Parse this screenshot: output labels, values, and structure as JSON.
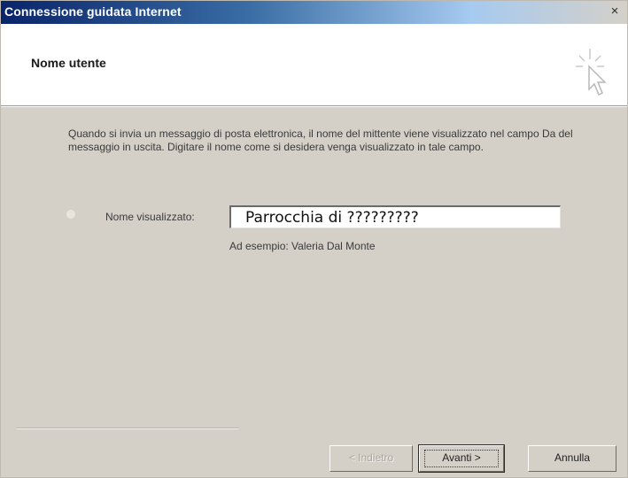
{
  "window": {
    "title": "Connessione guidata Internet",
    "close_symbol": "×"
  },
  "header": {
    "title": "Nome utente",
    "icon": "wizard-wand-icon"
  },
  "main": {
    "description": "Quando si invia un messaggio di posta elettronica, il nome del mittente viene visualizzato nel campo Da del messaggio in uscita. Digitare il nome come si desidera venga visualizzato in tale campo.",
    "display_name_label": "Nome visualizzato:",
    "display_name_value": "Parrocchia di ?????????",
    "example": "Ad esempio: Valeria Dal Monte"
  },
  "buttons": {
    "back": "< Indietro",
    "next": "Avanti >",
    "cancel": "Annulla"
  },
  "colors": {
    "title_bar_start": "#0a246a",
    "dialog_background": "#d4d0c8"
  }
}
